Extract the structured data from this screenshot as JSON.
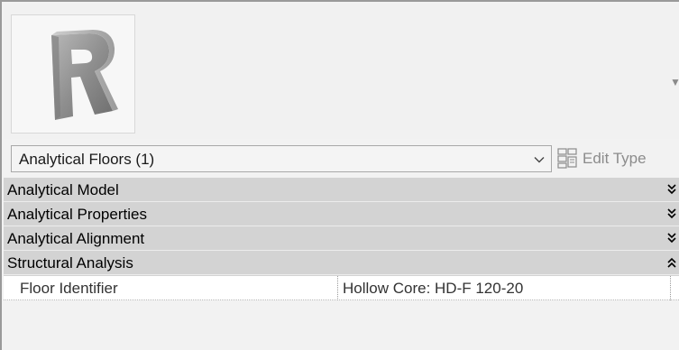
{
  "preview": {
    "logo_icon": "revit-logo-icon",
    "dropdown_icon": "triangle-down-icon"
  },
  "type_selector": {
    "selected": "Analytical Floors (1)",
    "chevron_icon": "chevron-down-icon"
  },
  "edit_type": {
    "label": "Edit Type",
    "icon": "edit-type-icon"
  },
  "groups": [
    {
      "label": "Analytical Model",
      "toggle_icon": "double-chevron-down-icon",
      "expanded": false
    },
    {
      "label": "Analytical Properties",
      "toggle_icon": "double-chevron-down-icon",
      "expanded": false
    },
    {
      "label": "Analytical Alignment",
      "toggle_icon": "double-chevron-down-icon",
      "expanded": false
    },
    {
      "label": "Structural Analysis",
      "toggle_icon": "double-chevron-up-icon",
      "expanded": true
    }
  ],
  "parameters": [
    {
      "name": "Floor Identifier",
      "value": "Hollow Core: HD-F 120-20"
    }
  ],
  "colors": {
    "group_header": "#d3d3d3",
    "logo_gray": "#9b9b9b",
    "disabled_text": "#8c8c8c"
  }
}
